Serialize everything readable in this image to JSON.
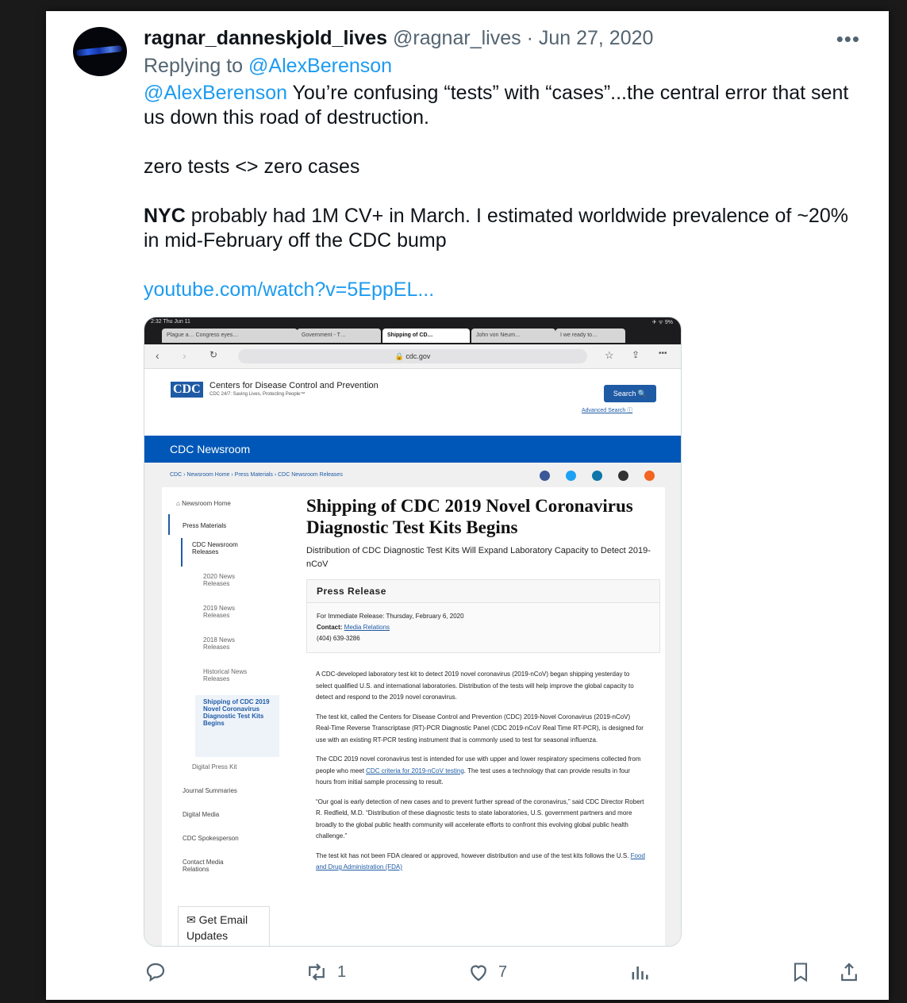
{
  "tweet": {
    "display_name": "ragnar_danneskjold_lives",
    "handle": "@ragnar_lives",
    "date": "· Jun 27, 2020",
    "more": "•••",
    "replying_prefix": "Replying to ",
    "replying_to": "@AlexBerenson",
    "mention": "@AlexBerenson",
    "line1": " You’re confusing “tests” with “cases”...the central error that sent us down this road of destruction.",
    "line2": "zero tests <> zero cases",
    "line3_bold": "NYC",
    "line3": " probably had 1M CV+ in March. I estimated worldwide prevalence of ~20% in mid-February off the CDC bump",
    "link": "youtube.com/watch?v=5EppEL..."
  },
  "screenshot": {
    "status_left": "2:32  Thu Jun 11",
    "status_right": "✈ ᯤ 9%",
    "tabs": [
      "Plague a…  Congress eyes…",
      "Government - T…",
      "Shipping of CD…",
      "John von Neum…",
      "I we ready to…"
    ],
    "url": "🔒 cdc.gov",
    "org_name": "Centers for Disease Control and Prevention",
    "org_tagline": "CDC 24/7: Saving Lives, Protecting People™",
    "logo": "CDC",
    "search_label": "Search 🔍",
    "advanced_search": "Advanced Search  ⓘ",
    "newsroom": "CDC Newsroom",
    "breadcrumbs": "CDC  ›  Newsroom Home  ›  Press Materials  ›  CDC Newsroom Releases",
    "sidebar": {
      "home": "Newsroom Home",
      "press": "Press Materials",
      "releases": "CDC Newsroom Releases",
      "y2020": "2020 News Releases",
      "y2019": "2019 News Releases",
      "y2018": "2018 News Releases",
      "historical": "Historical News Releases",
      "current": "Shipping of CDC 2019 Novel Coronavirus Diagnostic Test Kits Begins",
      "digital_kit": "Digital Press Kit",
      "journal": "Journal Summaries",
      "media": "Digital Media",
      "spokesperson": "CDC Spokesperson",
      "contact": "Contact Media Relations",
      "email": "✉ Get Email Updates"
    },
    "title": "Shipping of CDC 2019 Novel Coronavirus Diagnostic Test Kits Begins",
    "subtitle": "Distribution of CDC Diagnostic Test Kits Will Expand Laboratory Capacity to Detect 2019-nCoV",
    "pr_heading": "Press Release",
    "pr_release": "For Immediate Release: Thursday, February 6, 2020",
    "pr_contact_label": "Contact: ",
    "pr_contact_link": "Media Relations",
    "pr_phone": "(404) 639-3286",
    "para1": "A CDC-developed laboratory test kit to detect 2019 novel coronavirus (2019-nCoV) began shipping yesterday to select qualified U.S. and international laboratories. Distribution of the tests will help improve the global capacity to detect and respond to the 2019 novel coronavirus.",
    "para2": "The test kit, called the Centers for Disease Control and Prevention (CDC) 2019-Novel Coronavirus (2019-nCoV) Real-Time Reverse Transcriptase (RT)-PCR Diagnostic Panel (CDC 2019-nCoV Real Time RT-PCR), is designed for use with an existing RT-PCR testing instrument that is commonly used to test for seasonal influenza.",
    "para3a": "The CDC 2019 novel coronavirus test is intended for use with upper and lower respiratory specimens collected from people who meet ",
    "para3link": "CDC criteria for 2019-nCoV testing",
    "para3b": ". The test uses a technology that can provide results in four hours from initial sample processing to result.",
    "para4": "“Our goal is early detection of new cases and to prevent further spread of the coronavirus,” said CDC Director Robert R. Redfield, M.D. “Distribution of these diagnostic tests to state laboratories, U.S. government partners and more broadly to the global public health community will accelerate efforts to confront this evolving global public health challenge.”",
    "para5a": "The test kit has not been FDA cleared or approved, however distribution and use of the test kits follows the U.S. ",
    "para5link": "Food and Drug Administration (FDA)"
  },
  "actions": {
    "retweets": "1",
    "likes": "7"
  },
  "colors": {
    "link": "#1d9bf0",
    "cdc_blue": "#0057b7"
  }
}
